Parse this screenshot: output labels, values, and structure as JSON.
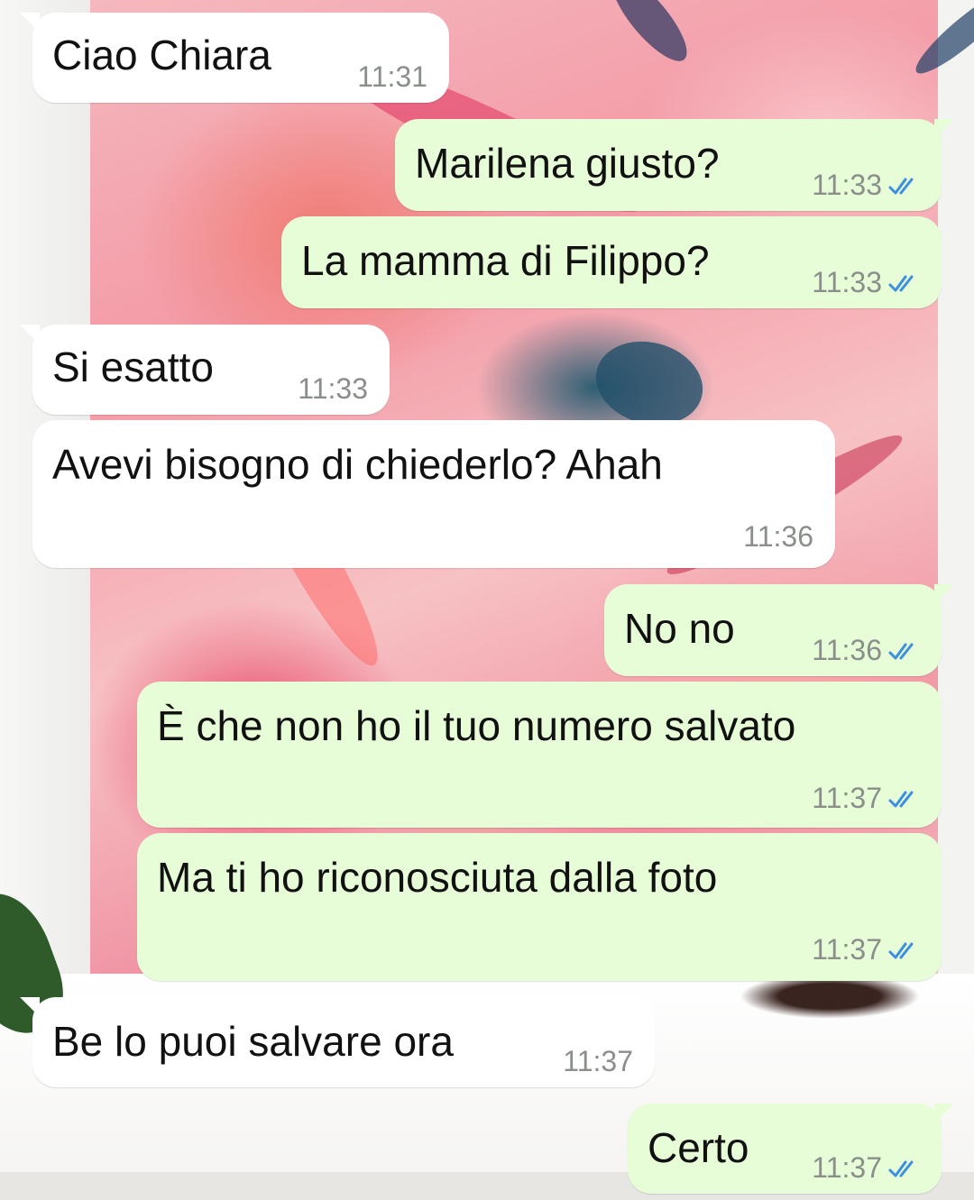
{
  "colors": {
    "incoming_bubble": "#ffffff",
    "outgoing_bubble": "#e7fdd7",
    "read_ticks": "#3b8fe0",
    "timestamp": "#8a8f8a"
  },
  "messages": [
    {
      "direction": "incoming",
      "text": "Ciao Chiara",
      "time": "11:31"
    },
    {
      "direction": "outgoing",
      "text": "Marilena giusto?",
      "time": "11:33",
      "status": "read"
    },
    {
      "direction": "outgoing",
      "text": "La mamma di Filippo?",
      "time": "11:33",
      "status": "read"
    },
    {
      "direction": "incoming",
      "text": "Si esatto",
      "time": "11:33"
    },
    {
      "direction": "incoming",
      "text": "Avevi bisogno di chiederlo? Ahah",
      "time": "11:36"
    },
    {
      "direction": "outgoing",
      "text": "No no",
      "time": "11:36",
      "status": "read"
    },
    {
      "direction": "outgoing",
      "text": "È che non ho il tuo numero salvato",
      "time": "11:37",
      "status": "read"
    },
    {
      "direction": "outgoing",
      "text": "Ma ti ho riconosciuta dalla foto",
      "time": "11:37",
      "status": "read"
    },
    {
      "direction": "incoming",
      "text": "Be lo puoi salvare ora",
      "time": "11:37"
    },
    {
      "direction": "outgoing",
      "text": "Certo",
      "time": "11:37",
      "status": "read"
    }
  ]
}
